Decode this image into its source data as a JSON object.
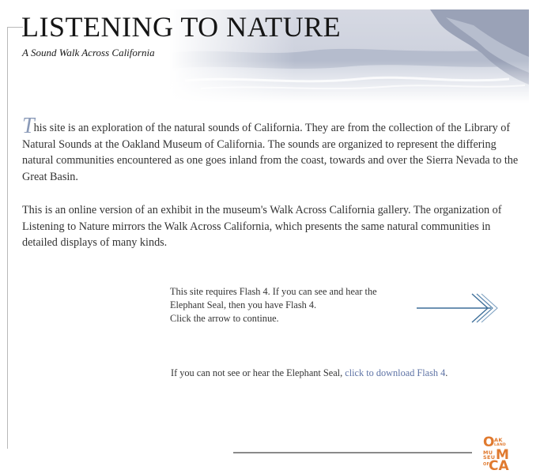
{
  "header": {
    "title": "LISTENING TO NATURE",
    "subtitle": "A Sound Walk Across California"
  },
  "intro": {
    "drop_cap": "T",
    "paragraph1_rest": "his site is an exploration of the natural sounds of California. They are from the collection of the Library of Natural Sounds at the Oakland Museum of California. The sounds are organized to represent the differing natural communities encountered as one goes inland from the coast, towards and over the Sierra Nevada to the Great Basin.",
    "paragraph2": "This is an online version of an exhibit in the museum's Walk Across California gallery. The organization of Listening to Nature mirrors the Walk Across California, which presents the same natural communities in detailed displays of many kinds."
  },
  "flash_notice": {
    "line1": "This site requires Flash 4. If you can see and hear the",
    "line2": "Elephant Seal, then you have Flash 4.",
    "line3": "Click the arrow to continue."
  },
  "continue_arrow": {
    "icon": "triple-chevron-right-arrow-icon",
    "color": "#3d6e99"
  },
  "download": {
    "prefix": "If you can not see or hear the Elephant Seal, ",
    "link_text": "click to download Flash 4",
    "suffix": ".",
    "link_color": "#5f74a6"
  },
  "logo": {
    "brand_color": "#e07a2f",
    "rows": [
      {
        "big": "O",
        "small_top": "AK",
        "small_bottom": "LAND"
      },
      {
        "big": "M",
        "small_top": "MU",
        "small_bottom": "SEU"
      },
      {
        "big": "CA",
        "small_top": "OF",
        "small_bottom": ""
      }
    ]
  }
}
